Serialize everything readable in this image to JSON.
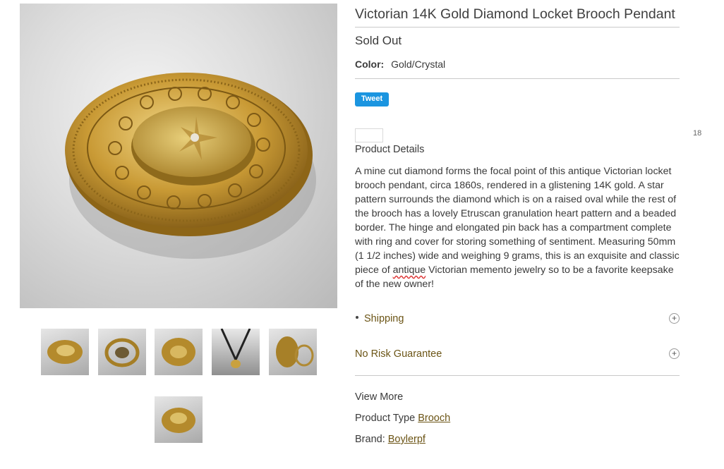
{
  "product": {
    "title": "Victorian 14K Gold Diamond Locket Brooch Pendant",
    "status": "Sold Out",
    "color_label": "Color:",
    "color_value": "Gold/Crystal",
    "tweet_label": "Tweet",
    "share_count": "18",
    "details_heading": "Product Details",
    "description_part1": "A mine cut diamond forms the focal point of this antique Victorian locket brooch pendant, circa 1860s, rendered in a glistening 14K gold. A star pattern surrounds the diamond which is on a raised oval while the rest of the brooch has a lovely Etruscan granulation heart pattern and a beaded border. The hinge and elongated pin back has a compartment complete with ring and cover for storing something of sentiment. Measuring 50mm (1 1/2 inches) wide and weighing 9 grams, this is an exquisite and classic piece of ",
    "description_spell": "antique",
    "description_part2": " Victorian memento jewelry so to be a favorite keepsake of the new owner!"
  },
  "accordion": [
    {
      "label": "Shipping",
      "icon": "plus-circle-icon"
    },
    {
      "label": "No Risk Guarantee",
      "icon": "plus-circle-icon"
    }
  ],
  "view_more": "View More",
  "product_type": {
    "label": "Product Type",
    "value": "Brooch"
  },
  "brand": {
    "label": "Brand:",
    "value": "Boylerpf"
  },
  "thumbnails": [
    "brooch-front",
    "brooch-open",
    "brooch-angle",
    "pendant-necklace",
    "brooch-back-ring",
    "brooch-side"
  ],
  "colors": {
    "link": "#6b5415",
    "tweet": "#1b95e0",
    "gold": "#c9a13f"
  }
}
